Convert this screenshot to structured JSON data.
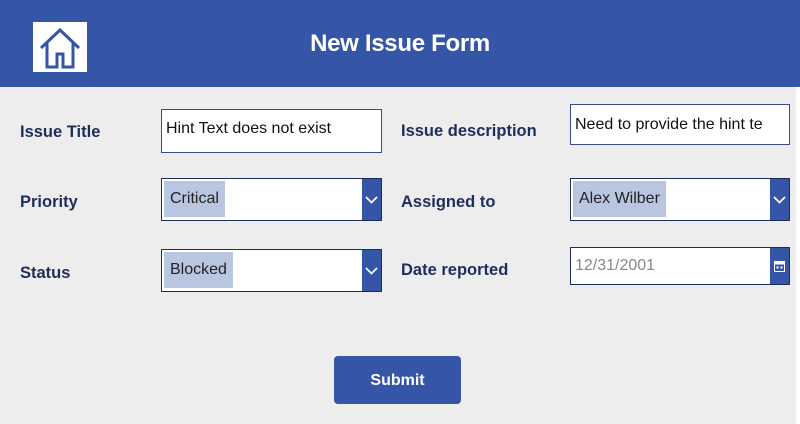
{
  "header": {
    "title": "New Issue Form",
    "home_icon": "home-icon",
    "background": "#3556a6"
  },
  "form": {
    "issue_title": {
      "label": "Issue Title",
      "value": "Hint Text does not exist"
    },
    "issue_description": {
      "label": "Issue description",
      "value": "Need to provide the hint te"
    },
    "priority": {
      "label": "Priority",
      "selected": "Critical",
      "icon": "chevron-down-icon"
    },
    "assigned_to": {
      "label": "Assigned to",
      "selected": "Alex Wilber",
      "icon": "chevron-down-icon"
    },
    "status": {
      "label": "Status",
      "selected": "Blocked",
      "icon": "chevron-down-icon"
    },
    "date_reported": {
      "label": "Date reported",
      "value": "12/31/2001",
      "icon": "calendar-icon"
    },
    "submit_label": "Submit"
  },
  "colors": {
    "accent": "#3556a6",
    "label_text": "#1f2d5c",
    "selected_highlight": "#b9c6e0",
    "page_background": "#ededed"
  }
}
